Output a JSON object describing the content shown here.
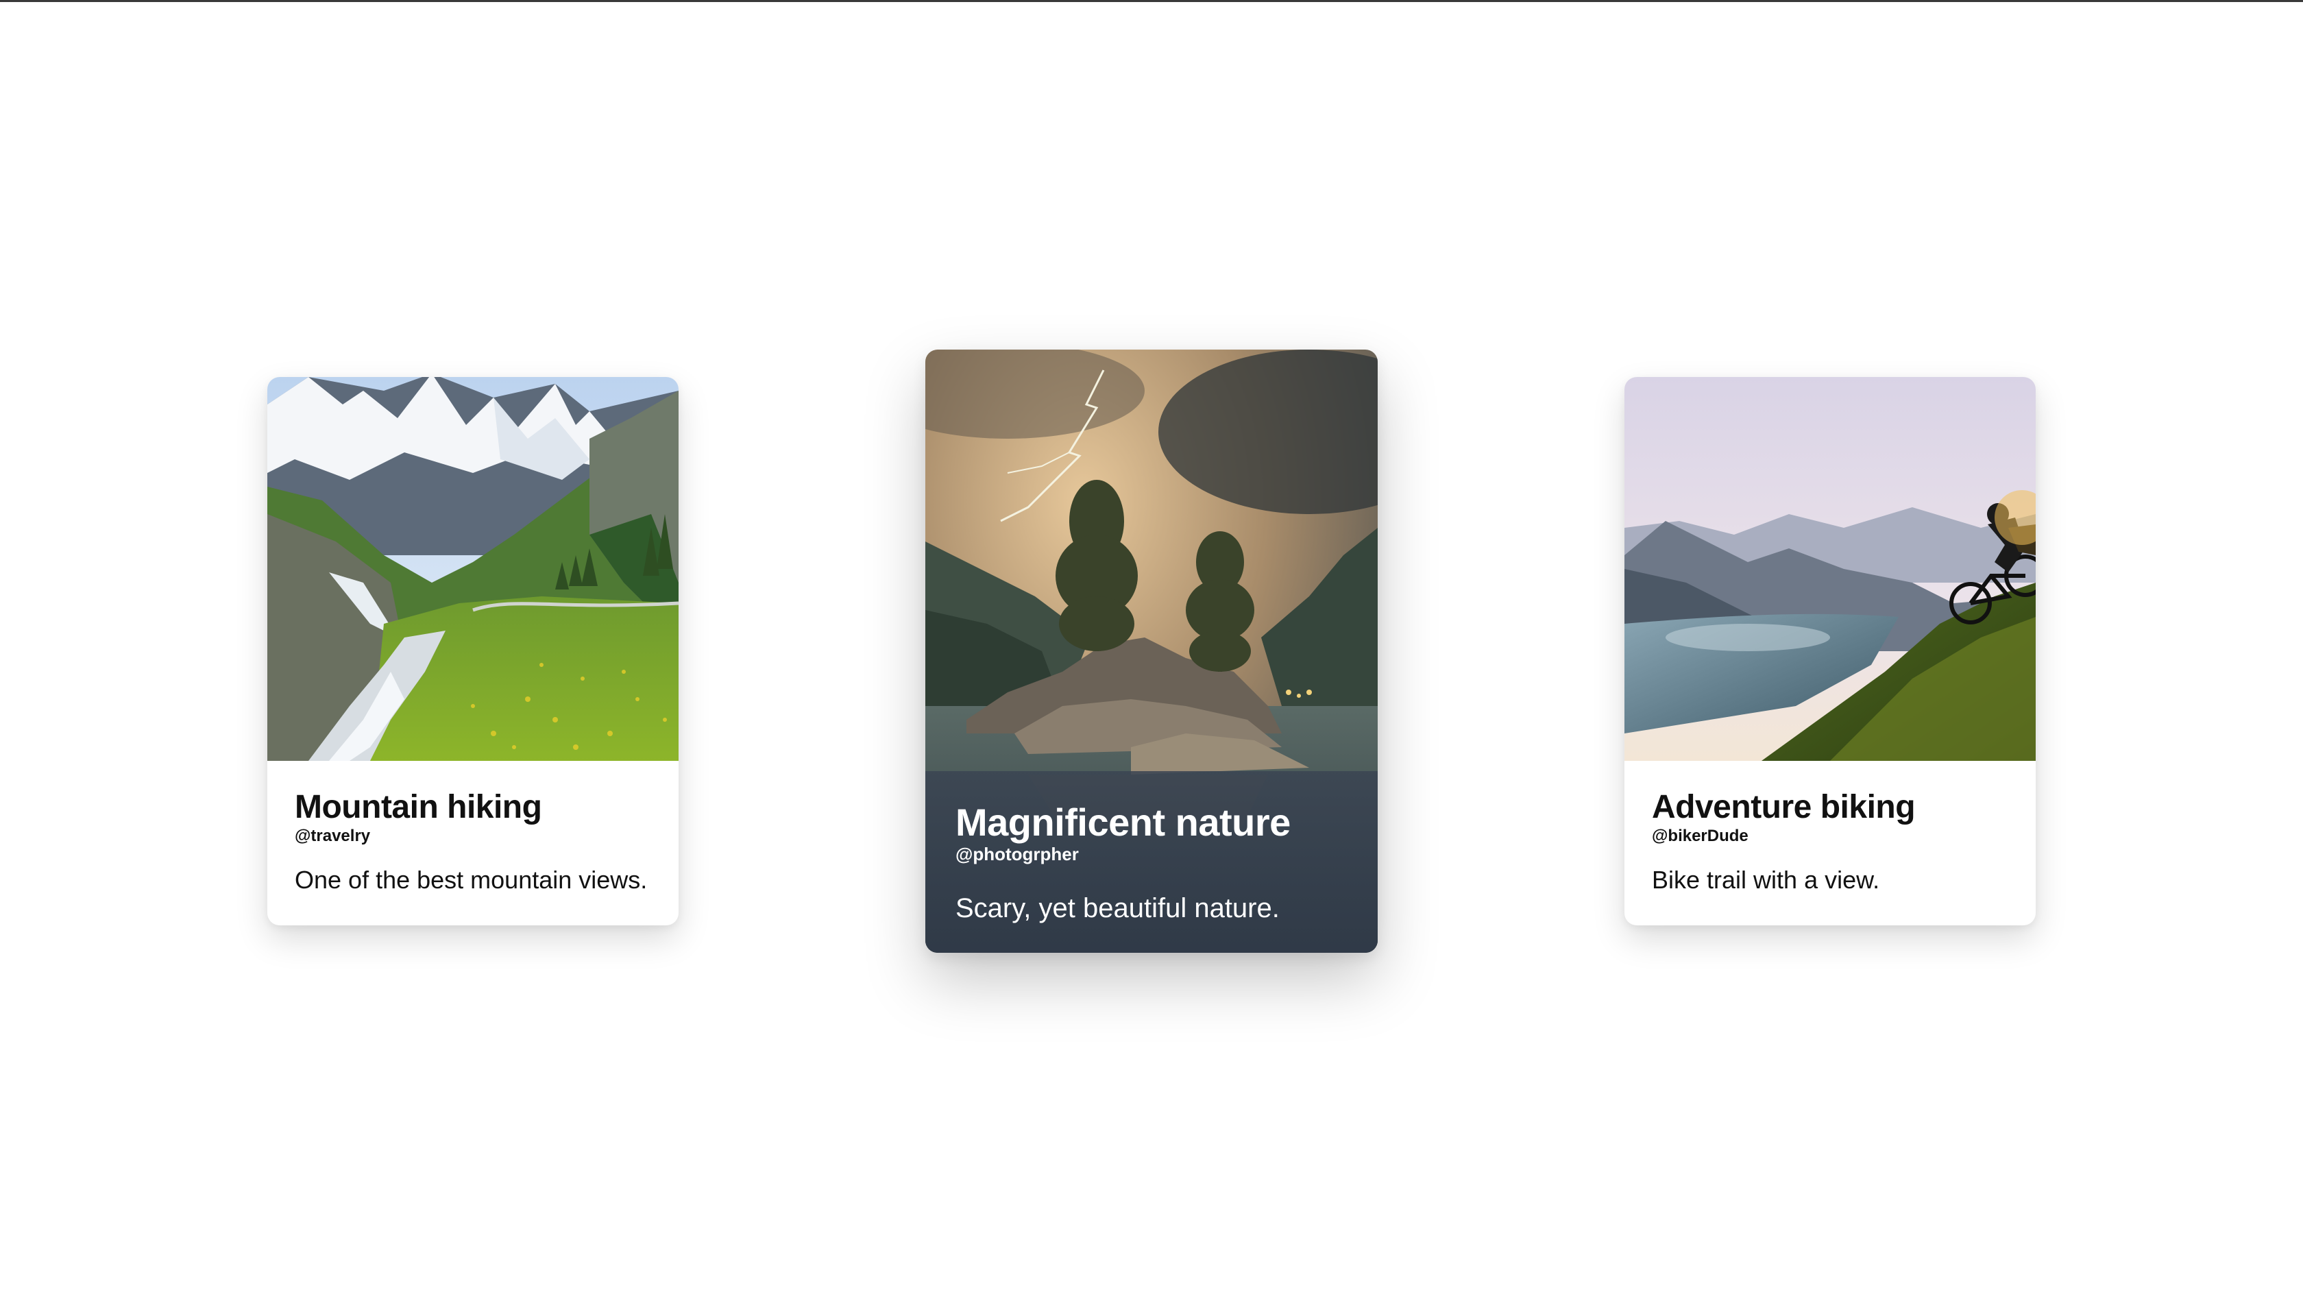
{
  "cards": [
    {
      "title": "Mountain hiking",
      "handle": "@travelry",
      "description": "One of the best mountain views.",
      "image": "alpine-valley-photo"
    },
    {
      "title": "Magnificent nature",
      "handle": "@photogrpher",
      "description": "Scary, yet beautiful nature.",
      "image": "stormy-island-photo"
    },
    {
      "title": "Adventure biking",
      "handle": "@bikerDude",
      "description": "Bike trail with a view.",
      "image": "lake-biker-photo"
    }
  ],
  "colors": {
    "card_overlay": "#3a4452",
    "text_dark": "#111111",
    "text_light": "#ffffff"
  }
}
